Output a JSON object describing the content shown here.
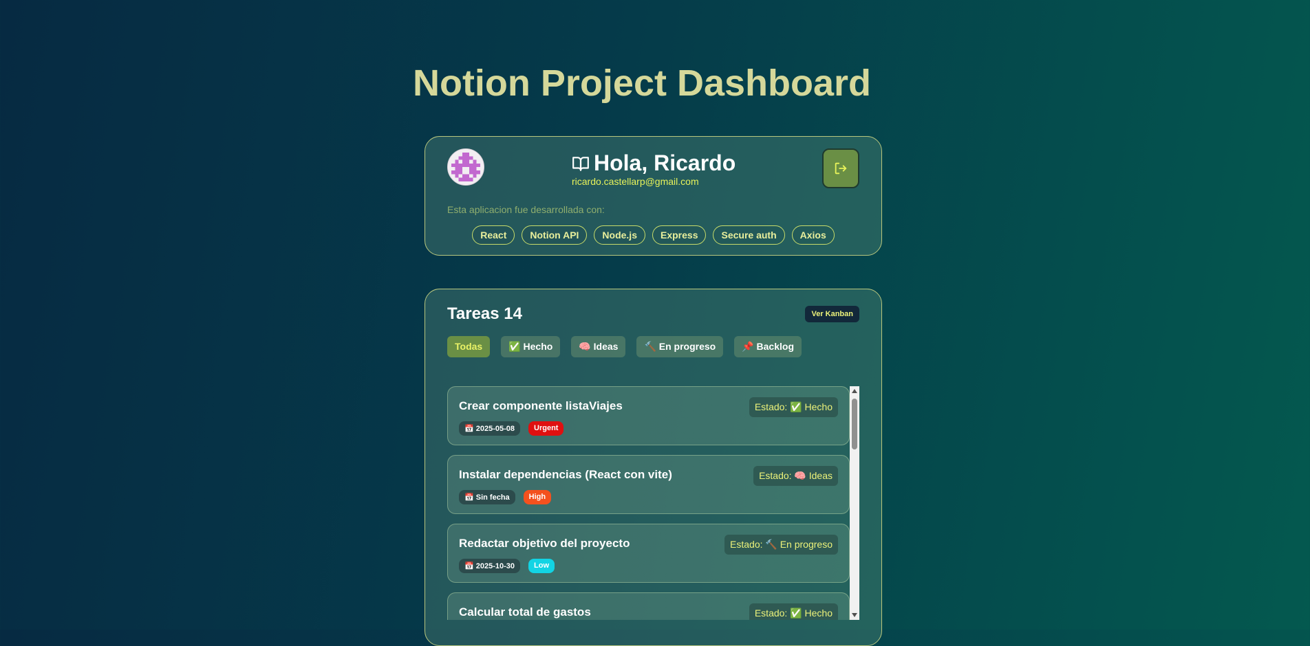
{
  "header": {
    "title": "Notion Project Dashboard"
  },
  "profile": {
    "greeting_icon": "book-open-icon",
    "greeting": "Hola, Ricardo",
    "email": "ricardo.castellarp@gmail.com",
    "logout_icon": "logout-icon",
    "dev_note": "Esta aplicacion fue desarrollada con:",
    "tech": [
      "React",
      "Notion API",
      "Node.js",
      "Express",
      "Secure auth",
      "Axios"
    ]
  },
  "tasks": {
    "title": "Tareas 14",
    "kanban_label": "Ver Kanban",
    "filters": [
      {
        "label": "Todas"
      },
      {
        "label": "✅ Hecho"
      },
      {
        "label": "🧠 Ideas"
      },
      {
        "label": "🔨 En progreso"
      },
      {
        "label": "📌 Backlog"
      }
    ],
    "items": [
      {
        "title": "Crear componente listaViajes",
        "status": "Estado: ✅ Hecho",
        "date": "📅 2025-05-08",
        "priority": "Urgent",
        "priority_color": "#e01010"
      },
      {
        "title": "Instalar dependencias (React con vite)",
        "status": "Estado: 🧠 Ideas",
        "date": "📅 Sin fecha",
        "priority": "High",
        "priority_color": "#f4511e"
      },
      {
        "title": "Redactar objetivo del proyecto",
        "status": "Estado: 🔨 En progreso",
        "date": "📅 2025-10-30",
        "priority": "Low",
        "priority_color": "#12d4e4"
      },
      {
        "title": "Calcular total de gastos",
        "status": "Estado: ✅ Hecho",
        "date": "",
        "priority": "",
        "priority_color": ""
      }
    ]
  },
  "colors": {
    "accent": "#d5d89a",
    "highlight": "#ecf27a",
    "active_filter": "#6a8f45"
  }
}
